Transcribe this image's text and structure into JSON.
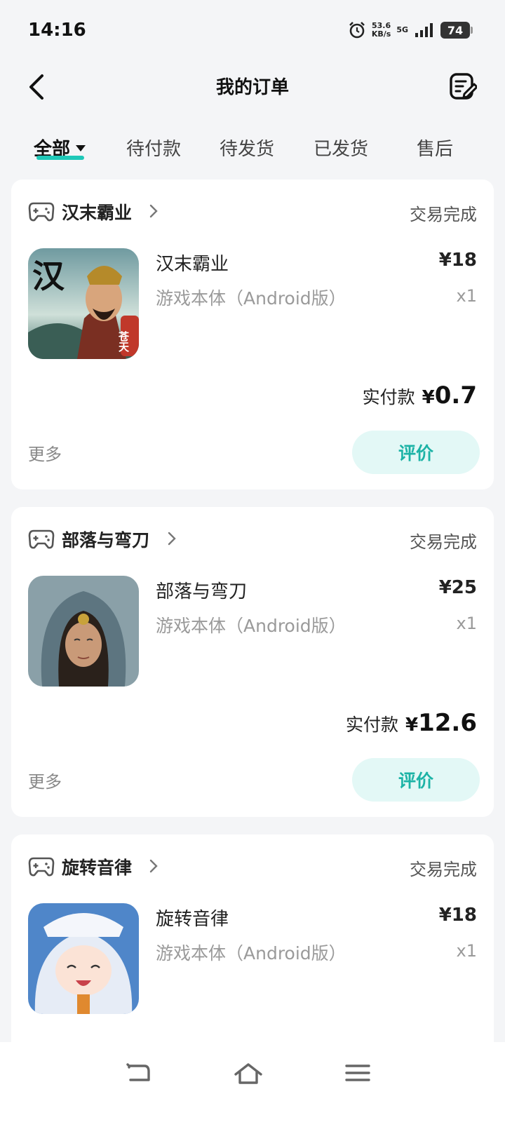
{
  "status_bar": {
    "time": "14:16",
    "net_speed_value": "53.6",
    "net_speed_unit": "KB/s",
    "network": "5G",
    "battery": "74",
    "icons": [
      "alarm-icon",
      "signal-icon",
      "battery-icon"
    ]
  },
  "header": {
    "title": "我的订单",
    "back_icon": "chevron-left-icon",
    "edit_icon": "edit-note-icon"
  },
  "tabs": [
    {
      "label": "全部",
      "active": true
    },
    {
      "label": "待付款",
      "active": false
    },
    {
      "label": "待发货",
      "active": false
    },
    {
      "label": "已发货",
      "active": false
    },
    {
      "label": "售后",
      "active": false
    }
  ],
  "orders": [
    {
      "store": "汉末霸业",
      "status": "交易完成",
      "item_name": "汉末霸业",
      "item_sub": "游戏本体（Android版）",
      "price": "¥18",
      "qty": "x1",
      "paid_label": "实付款",
      "paid_currency": "¥",
      "paid_value": "0.7",
      "more": "更多",
      "action": "评价",
      "thumb_char_1": "汉",
      "thumb_char_2": "苍天"
    },
    {
      "store": "部落与弯刀",
      "status": "交易完成",
      "item_name": "部落与弯刀",
      "item_sub": "游戏本体（Android版）",
      "price": "¥25",
      "qty": "x1",
      "paid_label": "实付款",
      "paid_currency": "¥",
      "paid_value": "12.6",
      "more": "更多",
      "action": "评价"
    },
    {
      "store": "旋转音律",
      "status": "交易完成",
      "item_name": "旋转音律",
      "item_sub": "游戏本体（Android版）",
      "price": "¥18",
      "qty": "x1"
    }
  ],
  "colors": {
    "accent": "#1fc8b8",
    "accent_text": "#1cb3a6",
    "accent_bg": "#e3f8f6",
    "page_bg": "#f4f5f7"
  }
}
